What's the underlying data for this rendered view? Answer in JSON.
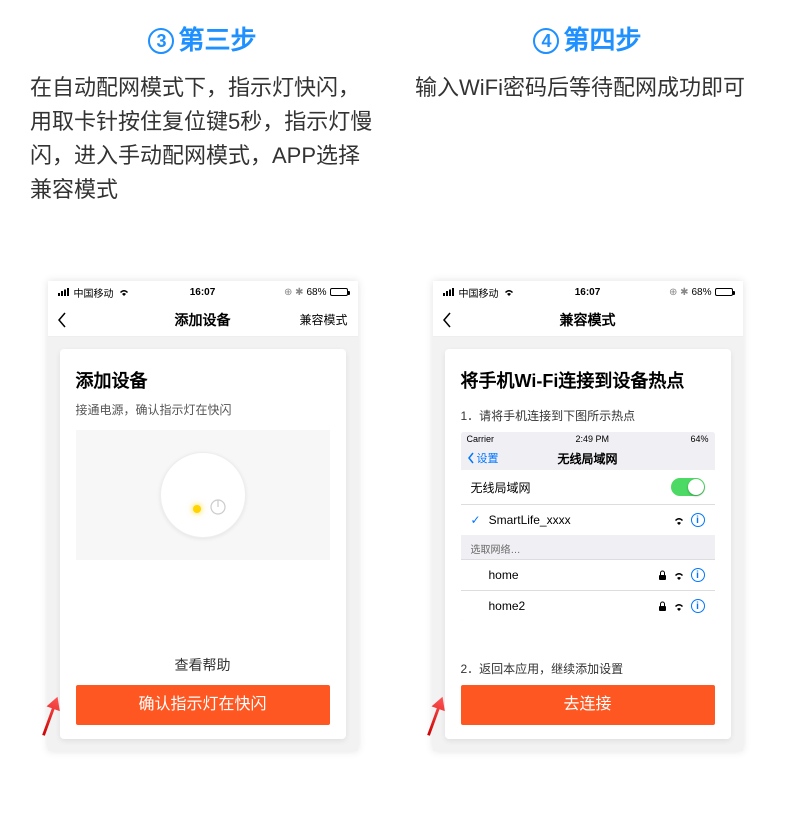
{
  "steps": [
    {
      "num": "3",
      "title": "第三步",
      "desc": "在自动配网模式下，指示灯快闪，用取卡针按住复位键5秒，指示灯慢闪，进入手动配网模式，APP选择兼容模式"
    },
    {
      "num": "4",
      "title": "第四步",
      "desc": "输入WiFi密码后等待配网成功即可"
    }
  ],
  "phoneLeft": {
    "status": {
      "carrier": "中国移动",
      "time": "16:07",
      "battery": "68%"
    },
    "nav": {
      "title": "添加设备",
      "right": "兼容模式"
    },
    "card": {
      "heading": "添加设备",
      "subtitle": "接通电源，确认指示灯在快闪",
      "help": "查看帮助",
      "button": "确认指示灯在快闪"
    }
  },
  "phoneRight": {
    "status": {
      "carrier": "中国移动",
      "time": "16:07",
      "battery": "68%"
    },
    "nav": {
      "title": "兼容模式"
    },
    "card": {
      "heading": "将手机Wi-Fi连接到设备热点",
      "step1": "1．请将手机连接到下图所示热点",
      "screenshot": {
        "status": {
          "carrier": "Carrier",
          "time": "2:49 PM",
          "battery": "64%"
        },
        "backLabel": "设置",
        "navTitle": "无线局域网",
        "toggleLabel": "无线局域网",
        "connected": "SmartLife_xxxx",
        "sectionLabel": "选取网络…",
        "networks": [
          "home",
          "home2"
        ]
      },
      "step2": "2．返回本应用，继续添加设置",
      "button": "去连接"
    }
  }
}
